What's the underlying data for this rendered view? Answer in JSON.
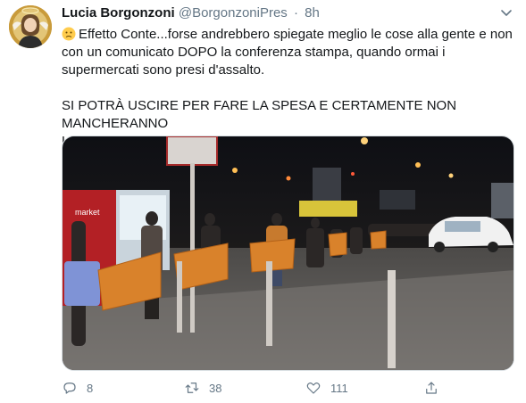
{
  "tweet": {
    "author_name": "Lucia Borgonzoni",
    "handle": "@BorgonzoniPres",
    "separator": "·",
    "time": "8h",
    "text_line1": "Effetto Conte...forse andrebbero spiegate meglio le cose alla gente e non",
    "text_line2": "con un comunicato DOPO la conferenza stampa, quando ormai i",
    "text_line3": "supermercati sono presi d'assalto.",
    "text_line4": "SI POTRÀ USCIRE PER FARE LA SPESA E CERTAMENTE NON MANCHERANNO",
    "text_line5": "LE SCORTE NEI SUPERMERCATI",
    "emoji_icon": "confused-face-icon"
  },
  "photo": {
    "store_sign": "market"
  },
  "actions": {
    "replies": "8",
    "retweets": "38",
    "likes": "111"
  },
  "colors": {
    "text": "#14171a",
    "secondary": "#657786",
    "border": "#d8dee2"
  }
}
